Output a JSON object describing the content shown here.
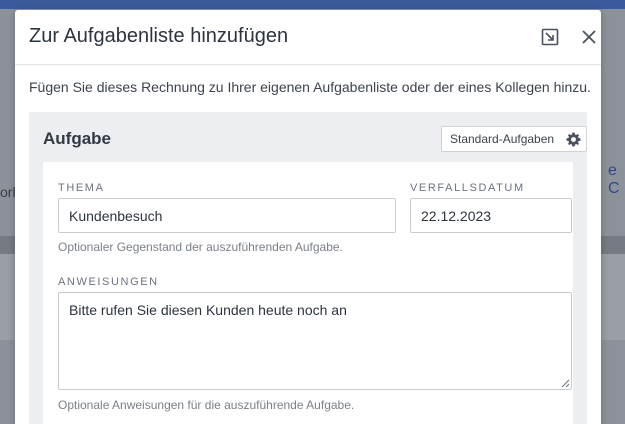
{
  "background": {
    "left_fragment": "orh",
    "right_fragment": "e C"
  },
  "dialog": {
    "title": "Zur Aufgabenliste hinzufügen",
    "description": "Fügen Sie dieses Rechnung zu Ihrer eigenen Aufgabenliste oder der eines Kollegen hinzu.",
    "icons": {
      "popout": "popout-icon",
      "close": "close-icon"
    }
  },
  "task": {
    "section_title": "Aufgabe",
    "standard_tasks_label": "Standard-Aufgaben",
    "settings_icon": "gear-icon",
    "subject": {
      "label": "THEMA",
      "value": "Kundenbesuch",
      "help": "Optionaler Gegenstand der auszuführenden Aufgabe."
    },
    "due_date": {
      "label": "VERFALLSDATUM",
      "value": "22.12.2023"
    },
    "instructions": {
      "label": "ANWEISUNGEN",
      "value": "Bitte rufen Sie diesen Kunden heute noch an",
      "help": "Optionale Anweisungen für die auszuführende Aufgabe."
    }
  },
  "colors": {
    "overlay_topbar": "#3b5a9c",
    "title_text": "#2c3440",
    "section_bg": "#edeef1"
  }
}
